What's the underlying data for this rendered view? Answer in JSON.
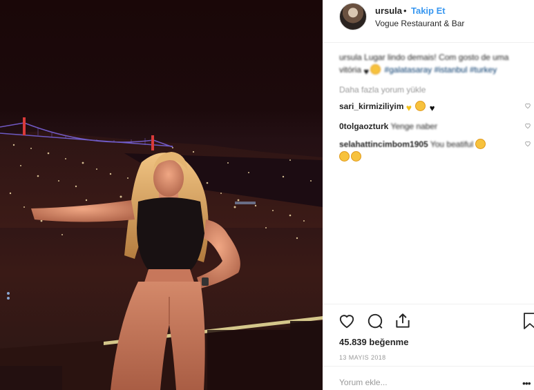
{
  "post": {
    "username": "ursula",
    "separator": "•",
    "follow_label": "Takip Et",
    "location": "Vogue Restaurant & Bar"
  },
  "caption": {
    "username": "ursula",
    "text": "Lugar lindo demais! Com gosto de uma vitória",
    "hashtags": "#galatasaray #istanbul #turkey"
  },
  "load_more_label": "Daha fazla yorum yükle",
  "comments": [
    {
      "username": "sari_kirmiziliyim",
      "text": ""
    },
    {
      "username": "0tolgaozturk",
      "text": "Yenge naber"
    },
    {
      "username": "selahattincimbom1905",
      "text": "You beatiful"
    }
  ],
  "stats": {
    "likes": "45.839 beğenme",
    "date": "13 MAYIS 2018"
  },
  "add_comment": {
    "placeholder": "Yorum ekle...",
    "more_label": "•••"
  },
  "icons": {
    "like": "heart-icon",
    "comment": "comment-icon",
    "share": "share-icon",
    "save": "bookmark-icon"
  },
  "colors": {
    "link_blue": "#3897f0",
    "text": "#262626",
    "muted": "#999999",
    "border": "#efefef"
  }
}
